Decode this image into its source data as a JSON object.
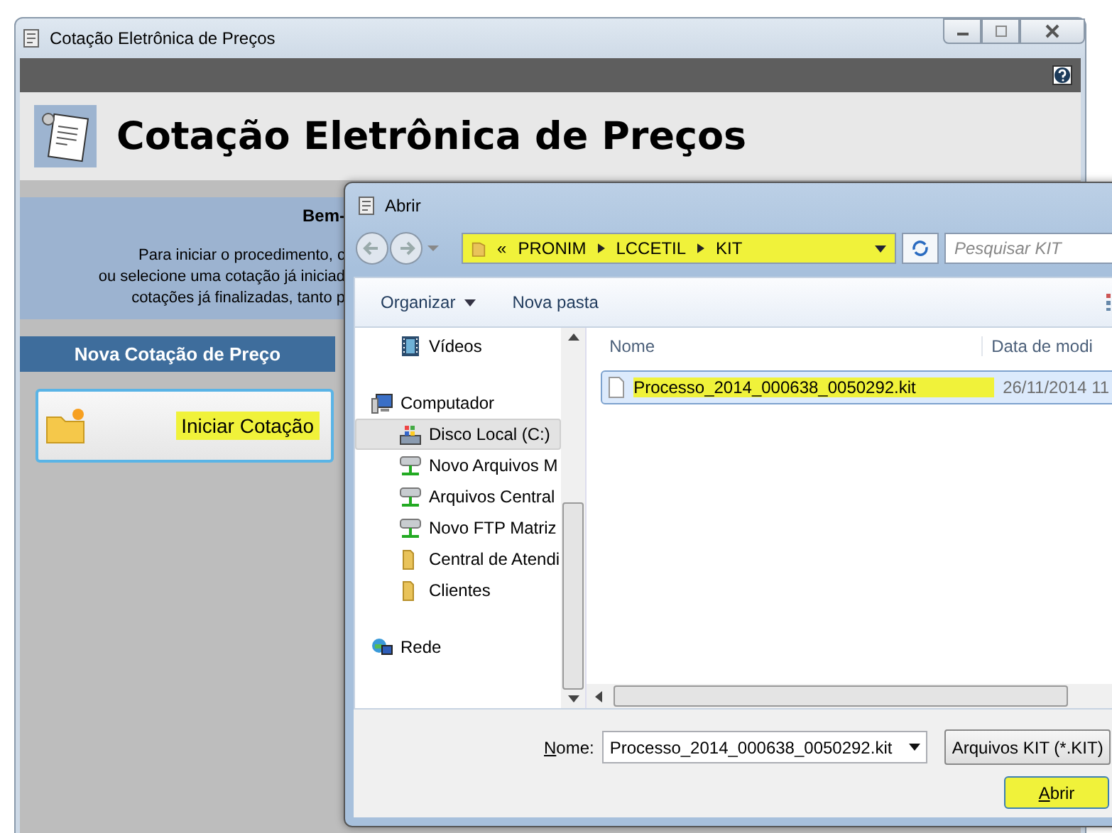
{
  "app_window": {
    "title": "Cotação Eletrônica de Preços"
  },
  "header": {
    "title": "Cotação Eletrônica de Preços"
  },
  "welcome": {
    "heading": "Bem-",
    "lines": [
      "Para iniciar o procedimento, c",
      "ou selecione uma cotação já iniciad",
      "cotações já finalizadas, tanto p"
    ]
  },
  "new_quote": {
    "heading": "Nova Cotação de Preço",
    "button": {
      "label": "Iniciar Cotação",
      "highlighted": true
    }
  },
  "dialog": {
    "title": "Abrir",
    "address": {
      "prefix": "«",
      "segments": [
        "PRONIM",
        "LCCETIL",
        "KIT"
      ],
      "highlighted": true
    },
    "search": {
      "placeholder": "Pesquisar KIT"
    },
    "toolbar": [
      {
        "label": "Organizar",
        "kind": "menu"
      },
      {
        "label": "Nova pasta",
        "kind": "plain"
      }
    ],
    "nav_tree": [
      {
        "children": [
          {
            "label": "Vídeos",
            "kind": "video",
            "selected": false
          }
        ]
      },
      {
        "label": "Computador",
        "kind": "computer",
        "selected": false,
        "children": [
          {
            "label": "Disco Local (C:)",
            "kind": "drive",
            "selected": true
          },
          {
            "label": "Novo Arquivos M",
            "kind": "netdrive",
            "selected": false
          },
          {
            "label": "Arquivos Central",
            "kind": "netdrive",
            "selected": false
          },
          {
            "label": "Novo FTP Matriz",
            "kind": "netdrive",
            "selected": false
          },
          {
            "label": "Central de Atendi",
            "kind": "folder",
            "selected": false
          },
          {
            "label": "Clientes",
            "kind": "folder",
            "selected": false
          }
        ]
      },
      {
        "label": "Rede",
        "kind": "network",
        "selected": false
      }
    ],
    "columns": [
      "Nome",
      "Data de modi"
    ],
    "files": [
      {
        "name": "Processo_2014_000638_0050292.kit",
        "date": "26/11/2014 11",
        "selected": true,
        "highlighted": true
      }
    ],
    "filename": {
      "label": "Nome:",
      "value": "Processo_2014_000638_0050292.kit"
    },
    "filetype": "Arquivos KIT (*.KIT)",
    "open_button": {
      "label": "Abrir",
      "highlighted": true
    }
  }
}
